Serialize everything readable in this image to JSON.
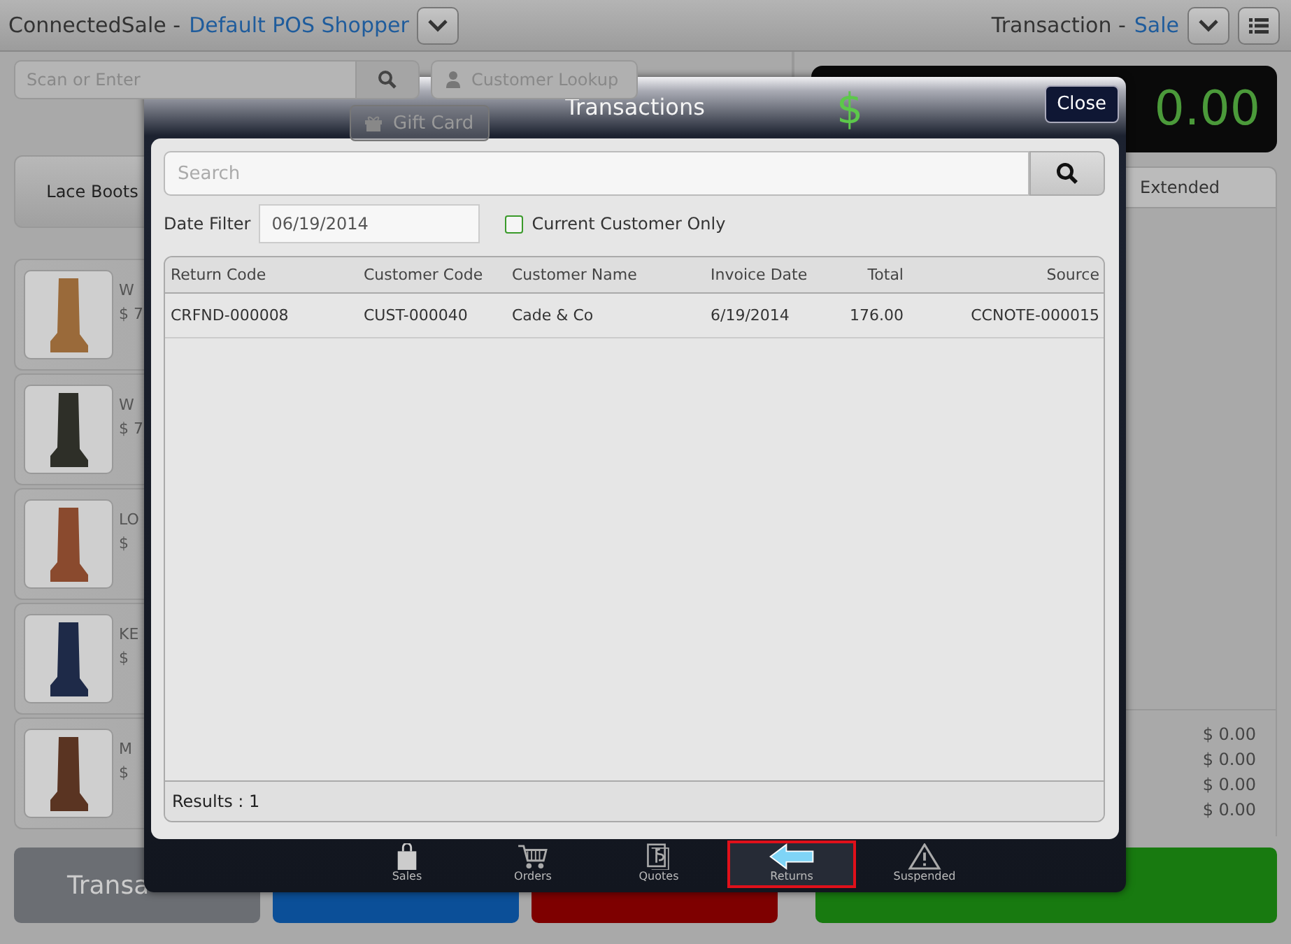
{
  "header": {
    "app": "ConnectedSale -",
    "shopper": "Default POS Shopper",
    "transaction_label": "Transaction -",
    "transaction_type": "Sale"
  },
  "scan": {
    "placeholder": "Scan or Enter"
  },
  "customer_lookup": "Customer Lookup",
  "gift_card": "Gift Card",
  "category": "Lace Boots",
  "products": [
    {
      "name": "W",
      "price": "$ 7"
    },
    {
      "name": "W",
      "price": "$ 7"
    },
    {
      "name": "LO",
      "price": "$"
    },
    {
      "name": "KE",
      "price": "$"
    },
    {
      "name": "M",
      "price": "$"
    }
  ],
  "total": {
    "currency": "$",
    "amount": "0.00"
  },
  "order_columns": [
    "Extended"
  ],
  "summary_amounts": [
    "$ 0.00",
    "$ 0.00",
    "$ 0.00",
    "$ 0.00"
  ],
  "bottom_buttons": [
    {
      "label": "Transa",
      "color": "#6b6e73"
    },
    {
      "color": "#0b4f98"
    },
    {
      "color": "#7e0000"
    },
    {
      "color": "#187a10"
    }
  ],
  "dialog": {
    "title": "Transactions",
    "close": "Close",
    "search": {
      "placeholder": "Search"
    },
    "date_filter": {
      "label": "Date Filter",
      "value": "06/19/2014"
    },
    "current_customer_only": {
      "label": "Current Customer Only",
      "checked": false
    },
    "table": {
      "columns": [
        "Return Code",
        "Customer Code",
        "Customer Name",
        "Invoice Date",
        "Total",
        "Source"
      ],
      "rows": [
        [
          "CRFND-000008",
          "CUST-000040",
          "Cade & Co",
          "6/19/2014",
          "176.00",
          "CCNOTE-000015"
        ]
      ]
    },
    "results": "Results : 1",
    "tabs": [
      {
        "kind": "sales",
        "label": "Sales",
        "selected": false
      },
      {
        "kind": "orders",
        "label": "Orders",
        "selected": false
      },
      {
        "kind": "quotes",
        "label": "Quotes",
        "selected": false
      },
      {
        "kind": "returns",
        "label": "Returns",
        "selected": true
      },
      {
        "kind": "suspended",
        "label": "Suspended",
        "selected": false
      }
    ]
  }
}
